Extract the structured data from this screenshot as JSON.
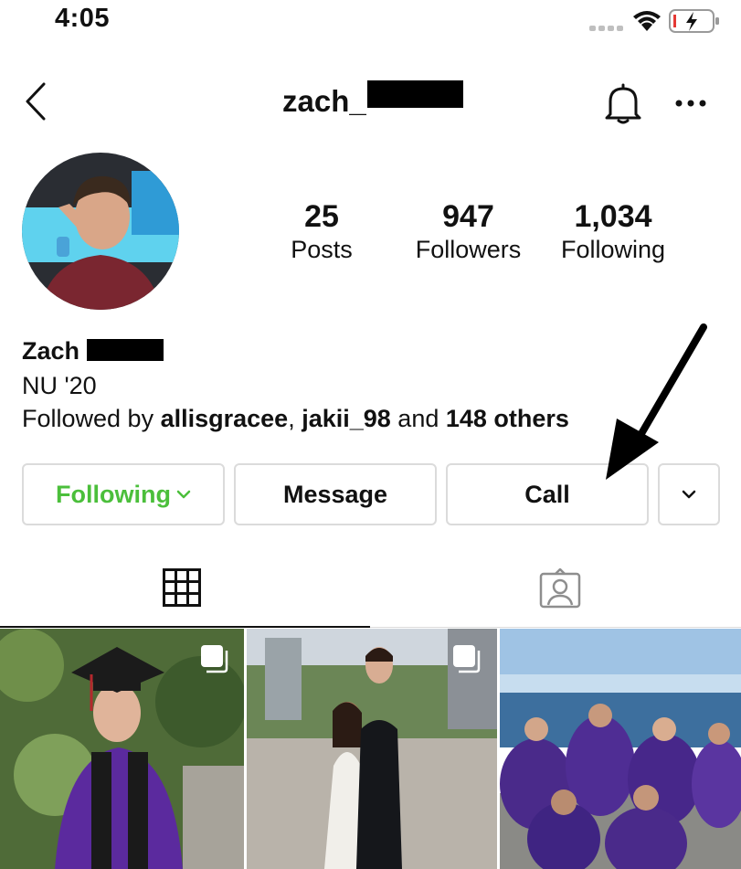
{
  "status_bar": {
    "time": "4:05"
  },
  "header": {
    "username": "zach_",
    "username_redacted": true
  },
  "profile": {
    "stats": [
      {
        "value": "25",
        "label": "Posts"
      },
      {
        "value": "947",
        "label": "Followers"
      },
      {
        "value": "1,034",
        "label": "Following"
      }
    ],
    "name": "Zach",
    "name_redacted": true,
    "bio": "NU '20",
    "followed_by": {
      "prefix": "Followed by ",
      "user1": "allisgracee",
      "separator": ", ",
      "user2": "jakii_98",
      "middle": " and ",
      "others": "148 others"
    }
  },
  "actions": {
    "following_label": "Following",
    "message_label": "Message",
    "call_label": "Call"
  },
  "colors": {
    "following_green": "#4bbf3b",
    "border": "#dbdbdb",
    "grad_purple": "#5b2a9e"
  },
  "icons": {
    "back": "back-chevron-icon",
    "notifications": "bell-icon",
    "more": "more-dots-icon",
    "grid_tab": "grid-icon",
    "tagged_tab": "tagged-person-icon",
    "multi_post": "carousel-icon"
  }
}
